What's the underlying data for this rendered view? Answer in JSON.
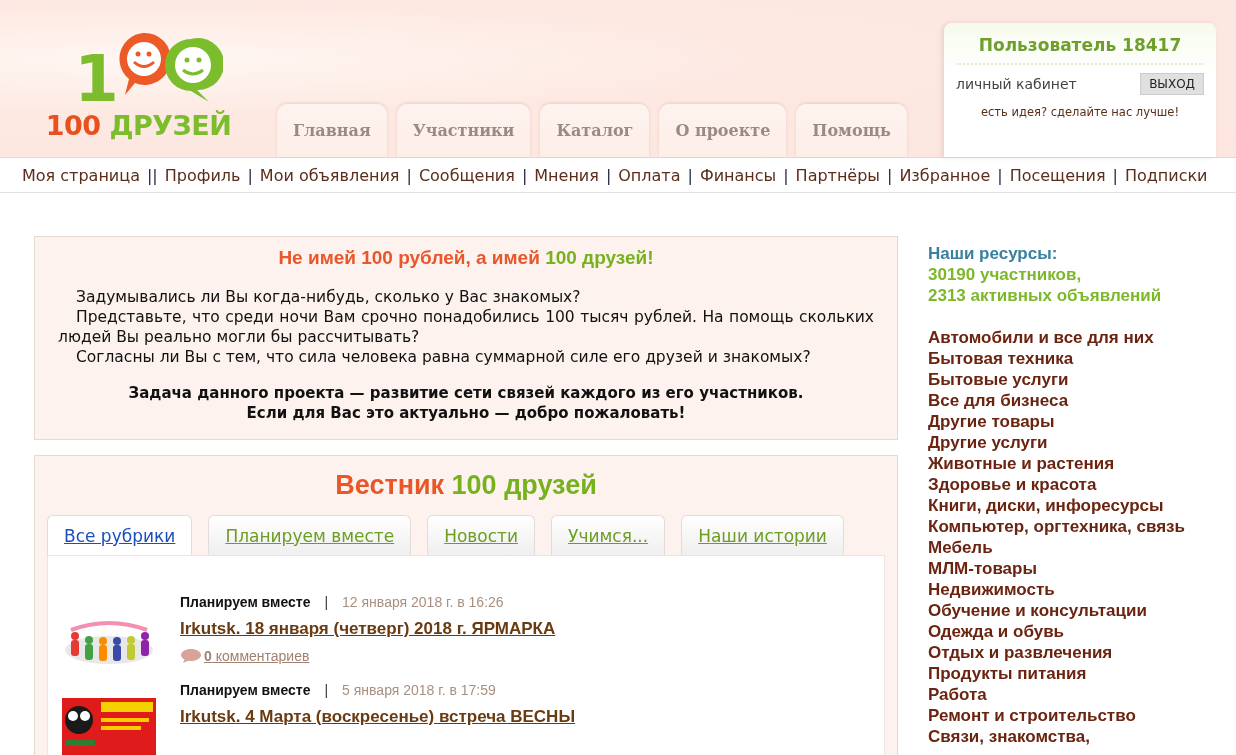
{
  "logo": {
    "digit": "1",
    "name_parts": [
      {
        "text": "100",
        "color": "#e8501e"
      },
      {
        "text": "ДРУЗЕЙ",
        "color": "#7cbd2e"
      }
    ]
  },
  "main_tabs": [
    {
      "label": "Главная",
      "selected": false
    },
    {
      "label": "Участники",
      "selected": false
    },
    {
      "label": "Каталог",
      "selected": false
    },
    {
      "label": "О проекте",
      "selected": false
    },
    {
      "label": "Помощь",
      "selected": false
    }
  ],
  "user_box": {
    "title": "Пользователь 18417",
    "cabinet_link": "личный кабинет",
    "logout_button": "ВЫХОД",
    "idea_link": "есть идея? сделайте нас лучше!"
  },
  "nav": [
    {
      "label": "Моя страница",
      "separator": "||"
    },
    {
      "label": "Профиль",
      "separator": "|"
    },
    {
      "label": "Мои объявления",
      "separator": "|"
    },
    {
      "label": "Сообщения",
      "separator": "|"
    },
    {
      "label": "Мнения",
      "separator": "|"
    },
    {
      "label": "Оплата",
      "separator": "|"
    },
    {
      "label": "Финансы",
      "separator": "|"
    },
    {
      "label": "Партнёры",
      "separator": "|"
    },
    {
      "label": "Избранное",
      "separator": "|"
    },
    {
      "label": "Посещения",
      "separator": "|"
    },
    {
      "label": "Подписки"
    }
  ],
  "intro": {
    "headline": [
      {
        "text": "Не имей 100 рублей, а имей ",
        "color": "#e8562a"
      },
      {
        "text": "100 друзей!",
        "color": "#76b21e"
      }
    ],
    "paragraphs": [
      "Задумывались ли Вы когда-нибудь, сколько у Вас знакомых?",
      "Представьте, что среди ночи Вам срочно понадобились 100 тысяч рублей. На помощь скольких людей Вы реально могли бы рассчитывать?",
      "Согласны ли Вы с тем, что сила человека равна суммарной силе его друзей и знакомых?"
    ],
    "mission": [
      "Задача данного проекта — развитие сети связей каждого из его участников.",
      "Если для Вас это актуально — добро пожаловать!"
    ]
  },
  "bulletin": {
    "title": [
      {
        "text": "Вестник ",
        "color": "#e8562a"
      },
      {
        "text": "100 друзей",
        "color": "#76b21e"
      }
    ],
    "tabs": [
      {
        "label": "Все рубрики",
        "selected": true
      },
      {
        "label": "Планируем вместе",
        "selected": false
      },
      {
        "label": "Новости",
        "selected": false
      },
      {
        "label": "Учимся...",
        "selected": false
      },
      {
        "label": "Наши истории",
        "selected": false
      }
    ],
    "articles": [
      {
        "kind": "picture",
        "category": "Планируем вместе",
        "separator": "|",
        "date": "12 января 2018 г. в 16:26",
        "title": "Irkutsk. 18 января (четверг) 2018 г. ЯРМАРКА",
        "comments": "**0** комментариев"
      },
      {
        "kind": "picture",
        "category": "Планируем вместе",
        "separator": "|",
        "date": "5 января 2018 г. в 17:59",
        "title": "Irkutsk. 4 Марта (воскресенье) встреча ВЕСНЫ"
      }
    ]
  },
  "resources": {
    "heading": "Наши ресурсы:",
    "stats": [
      "30190 участников,",
      "2313 активных объявлений"
    ],
    "categories": [
      "Автомобили и все для них",
      "Бытовая техника",
      "Бытовые услуги",
      "Все для бизнеса",
      "Другие товары",
      "Другие услуги",
      "Животные и растения",
      "Здоровье и красота",
      "Книги, диски, инфоресурсы",
      "Компьютер, оргтехника, связь",
      "Мебель",
      "МЛМ-товары",
      "Недвижимость",
      "Обучение и консультации",
      "Одежда и обувь",
      "Отдых и развлечения",
      "Продукты питания",
      "Работа",
      "Ремонт и строительство",
      "Связи, знакомства,"
    ]
  }
}
